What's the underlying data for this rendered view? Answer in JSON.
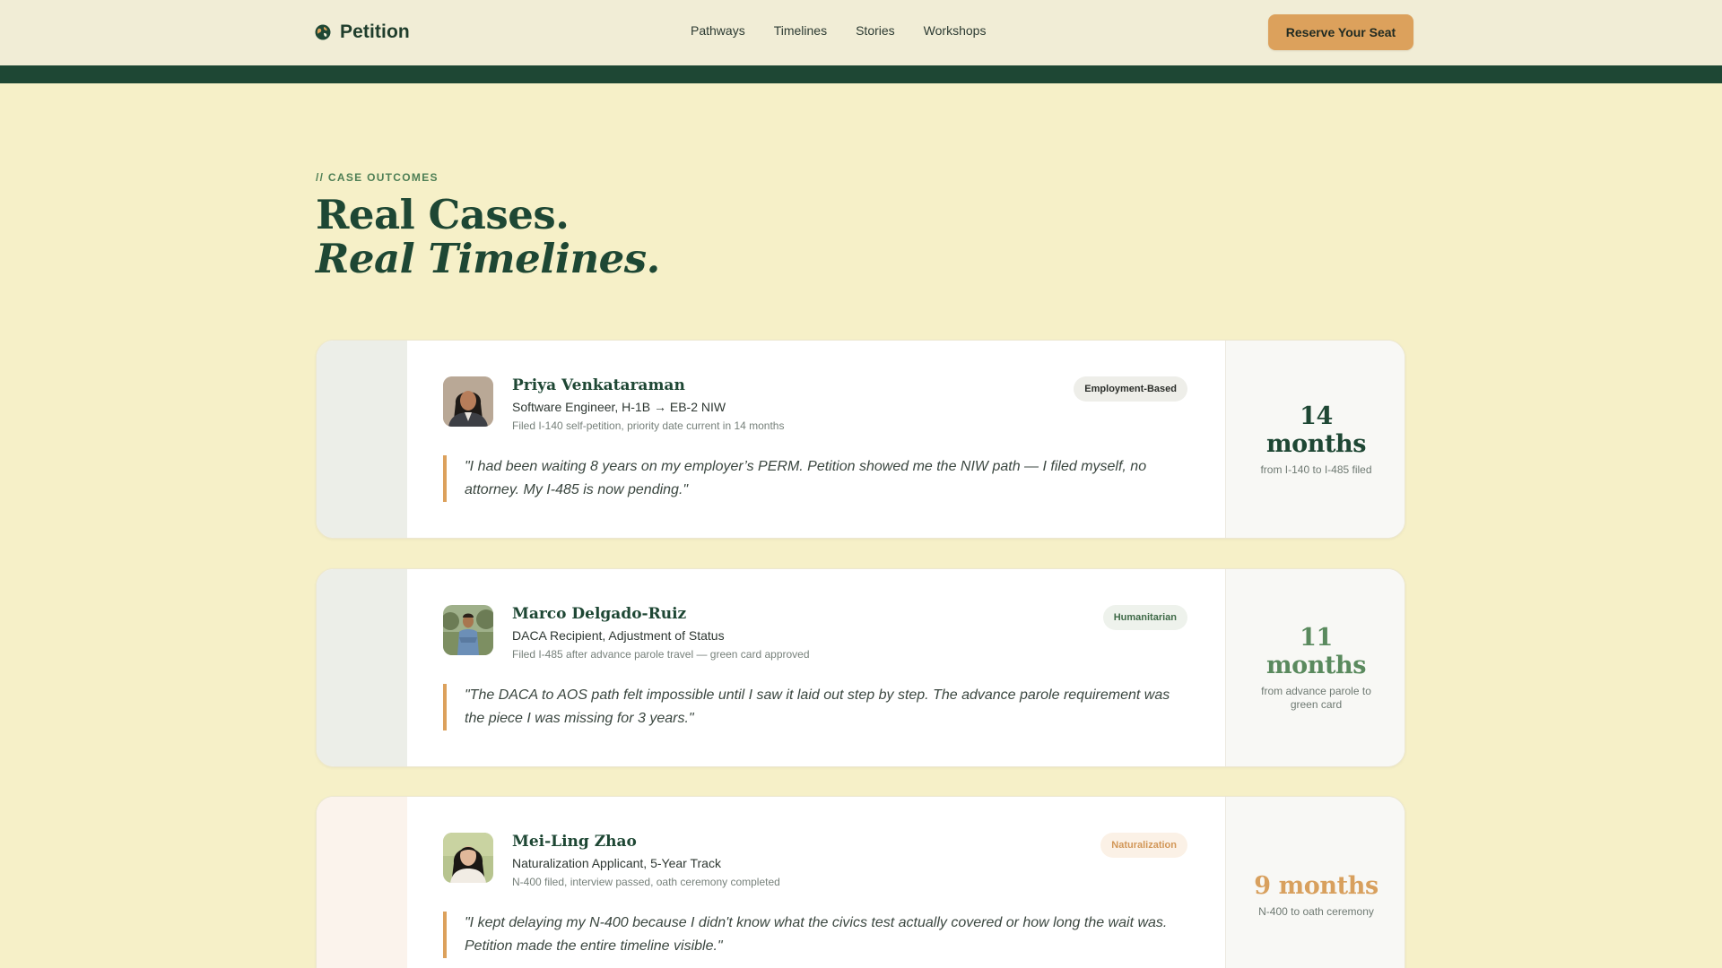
{
  "header": {
    "brand": "Petition",
    "nav": [
      "Pathways",
      "Timelines",
      "Stories",
      "Workshops"
    ],
    "cta": "Reserve Your Seat"
  },
  "section": {
    "eyebrow": "// CASE OUTCOMES",
    "headline_line1": "Real Cases.",
    "headline_line2": "Real Timelines."
  },
  "cases": [
    {
      "name": "Priya Venkataraman",
      "role": "Software Engineer, H-1B → EB-2 NIW",
      "detail": "Filed I-140 self-petition, priority date current in 14 months",
      "badge": "Employment-Based",
      "quote": "\"I had been waiting 8 years on my employer’s PERM. Petition showed me the NIW path — I filed myself, no attorney. My I-485 is now pending.\"",
      "stat_value": "14 months",
      "stat_caption": "from I-140 to I-485 filed"
    },
    {
      "name": "Marco Delgado-Ruiz",
      "role": "DACA Recipient, Adjustment of Status",
      "detail": "Filed I-485 after advance parole travel — green card approved",
      "badge": "Humanitarian",
      "quote": "\"The DACA to AOS path felt impossible until I saw it laid out step by step. The advance parole requirement was the piece I was missing for 3 years.\"",
      "stat_value": "11 months",
      "stat_caption": "from advance parole to green card"
    },
    {
      "name": "Mei-Ling Zhao",
      "role": "Naturalization Applicant, 5-Year Track",
      "detail": "N-400 filed, interview passed, oath ceremony completed",
      "badge": "Naturalization",
      "quote": "\"I kept delaying my N-400 because I didn't know what the civics test actually covered or how long the wait was. Petition made the entire timeline visible.\"",
      "stat_value": "9 months",
      "stat_caption": "N-400 to oath ceremony"
    }
  ],
  "colors": {
    "page_bg": "#f6f0c8",
    "header_bg": "#f1edd6",
    "brand_green": "#1e4734",
    "accent": "#dca15c"
  }
}
